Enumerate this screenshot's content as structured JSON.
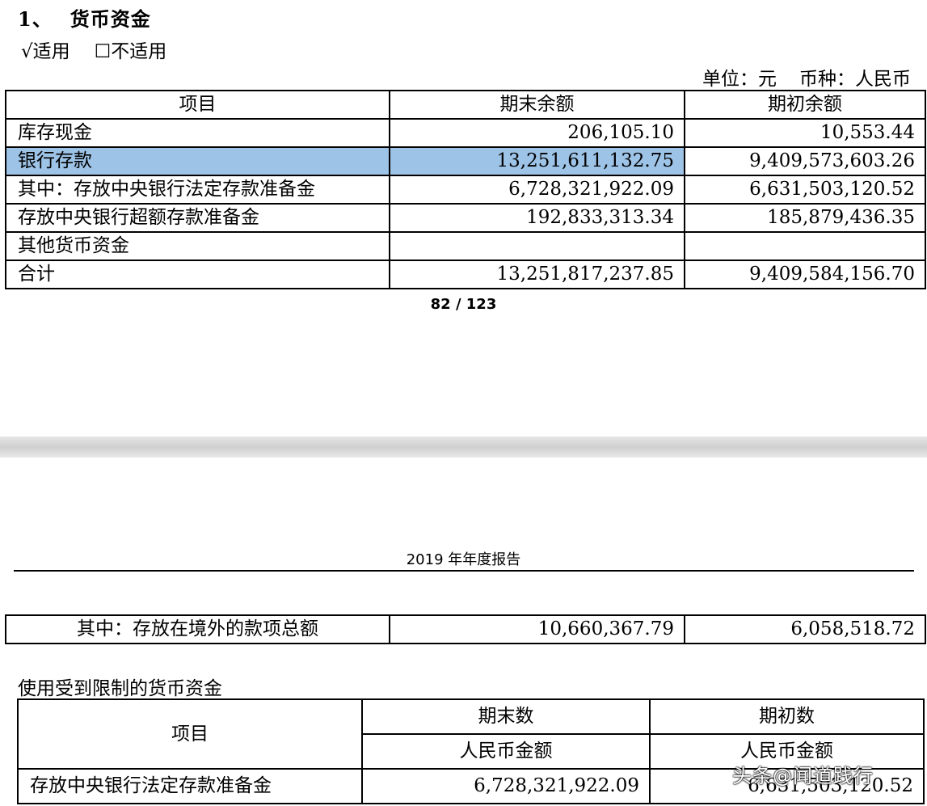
{
  "section": {
    "number": "1、",
    "title": "货币资金"
  },
  "options": {
    "applicable": "√适用",
    "not_applicable": "☐不适用"
  },
  "unit": {
    "unit_label": "单位：元",
    "currency_label": "币种：人民币"
  },
  "table1": {
    "headers": [
      "项目",
      "期末余额",
      "期初余额"
    ],
    "rows": [
      [
        "库存现金",
        "206,105.10",
        "10,553.44"
      ],
      [
        "银行存款",
        "13,251,611,132.75",
        "9,409,573,603.26"
      ],
      [
        "其中：存放中央银行法定存款准备金",
        "6,728,321,922.09",
        "6,631,503,120.52"
      ],
      [
        "存放中央银行超额存款准备金",
        "192,833,313.34",
        "185,879,436.35"
      ],
      [
        "其他货币资金",
        "",
        ""
      ],
      [
        "合计",
        "13,251,817,237.85",
        "9,409,584,156.70"
      ]
    ],
    "highlight_color": "#9dc3e6"
  },
  "page_number": "82 / 123",
  "report": {
    "year": "2019",
    "title_suffix": "年年度报告"
  },
  "table2": {
    "rows": [
      [
        "其中：存放在境外的款项总额",
        "10,660,367.79",
        "6,058,518.72"
      ]
    ]
  },
  "restricted": {
    "title": "使用受到限制的货币资金",
    "headers": {
      "item": "项目",
      "end": "期末数",
      "begin": "期初数",
      "rmb_end": "人民币金额",
      "rmb_begin": "人民币金额"
    },
    "rows": [
      [
        "存放中央银行法定存款准备金",
        "6,728,321,922.09",
        "6,631,503,120.52"
      ]
    ]
  },
  "watermark": "头条@闻道践行"
}
